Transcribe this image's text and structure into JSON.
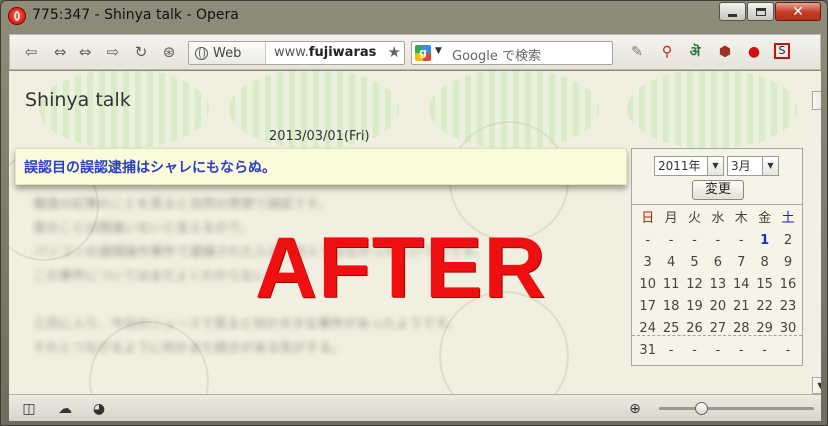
{
  "window": {
    "title": "775:347 - Shinya talk - Opera",
    "controls": {
      "minimize": "",
      "maximize": "",
      "close": "✕"
    }
  },
  "toolbar": {
    "address_badge": "Web",
    "url_prefix": "www.",
    "url_domain": "fujiwaras",
    "search_engine": "Google",
    "search_placeholder": "Google で検索"
  },
  "page": {
    "blog_title": "Shinya talk",
    "post_date": "2013/03/01(Fri)",
    "post_title": "誤認目の誤認逮捕はシャレにもならぬ。",
    "post_body_lines": [
      "報道の記事のことを見ると当然の思想で誤認です。",
      "昔のことは間違いないと言えるので。",
      "パソコンの遠隔操作事件で逮捕された人は、犯人ではなかったというのです。",
      "この事件についてはまだよくわからない。",
      "",
      "三月に入り、今日のニュースで見ると何か大きな事件があったようです。",
      "それとつながるように何かまた続きがある気がする。"
    ],
    "overlay_text": "AFTER"
  },
  "calendar": {
    "year": "2011年",
    "month": "3月",
    "submit": "変更",
    "weekdays": [
      "日",
      "月",
      "火",
      "水",
      "木",
      "金",
      "土"
    ],
    "weeks": [
      [
        "-",
        "-",
        "-",
        "-",
        "-",
        "1",
        "2"
      ],
      [
        "3",
        "4",
        "5",
        "6",
        "7",
        "8",
        "9"
      ],
      [
        "10",
        "11",
        "12",
        "13",
        "14",
        "15",
        "16"
      ],
      [
        "17",
        "18",
        "19",
        "20",
        "21",
        "22",
        "23"
      ],
      [
        "24",
        "25",
        "26",
        "27",
        "28",
        "29",
        "30"
      ],
      [
        "31",
        "-",
        "-",
        "-",
        "-",
        "-",
        "-"
      ]
    ],
    "highlighted_day": "1"
  },
  "statusbar": {
    "zoom_fraction": 0.27
  },
  "colors": {
    "post_title": "#2a3ec8",
    "overlay": "#ee1010",
    "sunday": "#d01010",
    "saturday": "#1020c8"
  }
}
